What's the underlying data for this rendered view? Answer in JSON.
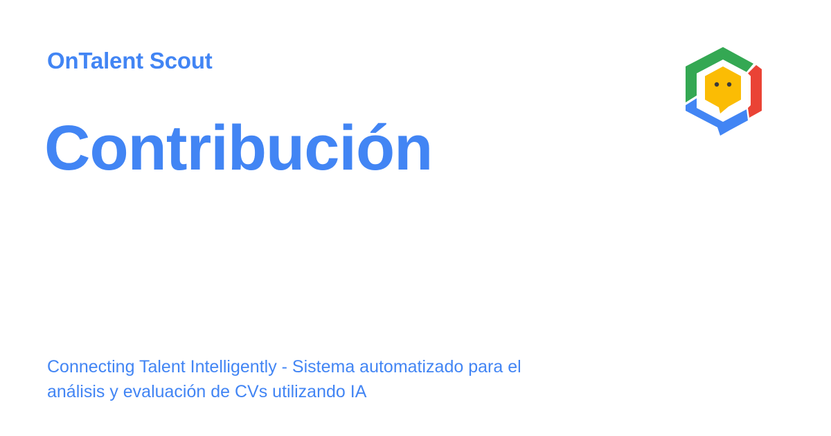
{
  "colors": {
    "brand_blue": "#4285f4",
    "logo_green": "#34a853",
    "logo_red": "#ea4335",
    "logo_yellow": "#fbbc04",
    "logo_blue": "#4285f4",
    "background": "#ffffff"
  },
  "header": {
    "site_name": "OnTalent Scout"
  },
  "main": {
    "title": "Contribución",
    "description_line1": "Connecting Talent Intelligently - Sistema automatizado para el",
    "description_line2": "análisis y evaluación de CVs utilizando IA"
  },
  "logo": {
    "icon": "hexagon-chat-bot-icon"
  }
}
